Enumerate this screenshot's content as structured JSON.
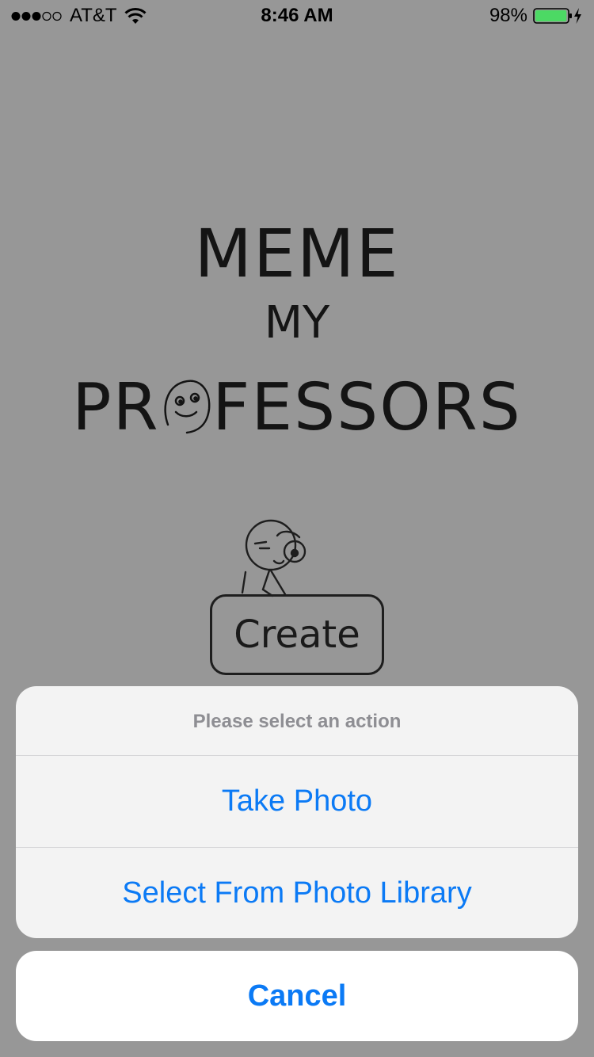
{
  "status_bar": {
    "carrier": "AT&T",
    "signal_bars_filled": 3,
    "signal_bars_total": 5,
    "time": "8:46 AM",
    "battery_percent": "98%",
    "battery_level": 0.98,
    "battery_color": "#4cd964",
    "charging": true
  },
  "logo": {
    "line1": "MEME",
    "line2": "MY",
    "line3": "PROFESSORS"
  },
  "main": {
    "create_label": "Create"
  },
  "action_sheet": {
    "title": "Please select an action",
    "actions": [
      {
        "label": "Take Photo"
      },
      {
        "label": "Select From Photo Library"
      }
    ],
    "cancel_label": "Cancel",
    "accent_color": "#0b7af5"
  }
}
